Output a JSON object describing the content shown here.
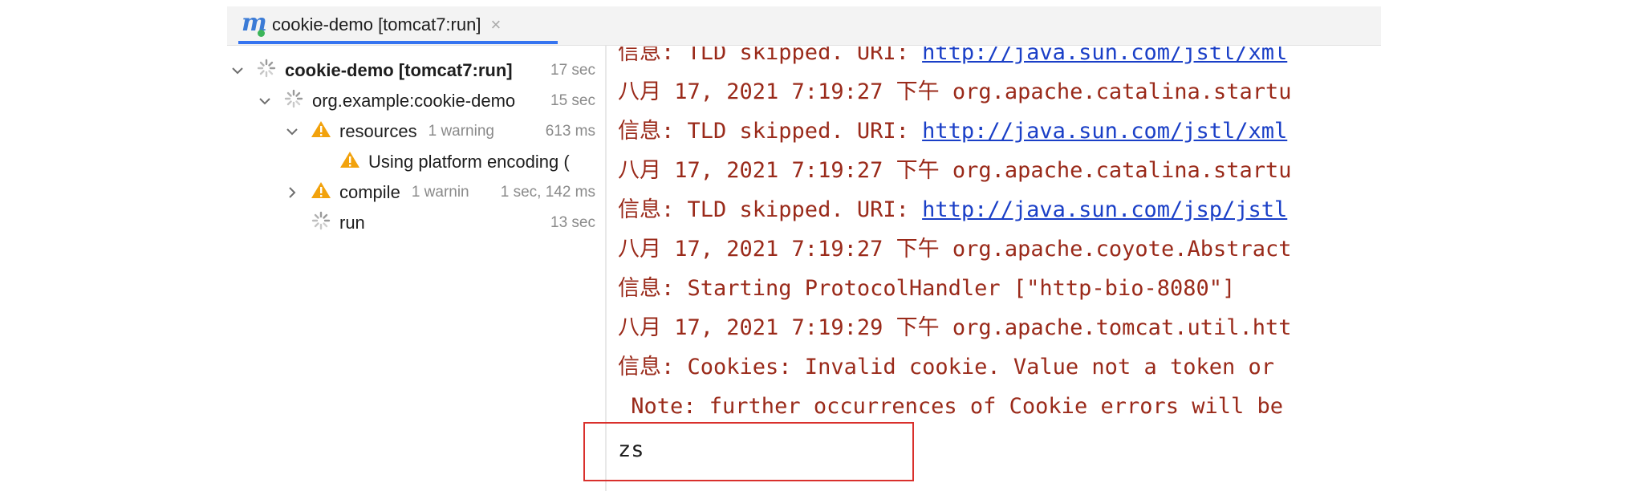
{
  "tab": {
    "title": "cookie-demo [tomcat7:run]",
    "close_glyph": "×"
  },
  "tree": {
    "root": {
      "label": "cookie-demo [tomcat7:run]",
      "time": "17 sec"
    },
    "module": {
      "label": "org.example:cookie-demo",
      "time": "15 sec"
    },
    "resources": {
      "label": "resources",
      "meta": "1 warning",
      "time": "613 ms"
    },
    "warning_msg": {
      "label": "Using platform encoding ("
    },
    "compile": {
      "label": "compile",
      "meta": "1 warnin",
      "time": "1 sec, 142 ms"
    },
    "run": {
      "label": "run",
      "time": "13 sec"
    }
  },
  "console": {
    "line0": {
      "text": "信息: TLD skipped. URI: ",
      "link": "http://java.sun.com/jstl/xml"
    },
    "line1": "八月 17, 2021 7:19:27 下午 org.apache.catalina.startu",
    "line2": {
      "text": "信息: TLD skipped. URI: ",
      "link": "http://java.sun.com/jstl/xml"
    },
    "line3": "八月 17, 2021 7:19:27 下午 org.apache.catalina.startu",
    "line4": {
      "text": "信息: TLD skipped. URI: ",
      "link": "http://java.sun.com/jsp/jstl"
    },
    "line5": "八月 17, 2021 7:19:27 下午 org.apache.coyote.Abstract",
    "line6": "信息: Starting ProtocolHandler [\"http-bio-8080\"]",
    "line7": "八月 17, 2021 7:19:29 下午 org.apache.tomcat.util.htt",
    "line8": "信息: Cookies: Invalid cookie. Value not a token or ",
    "line9": " Note: further occurrences of Cookie errors will be",
    "input": "zs"
  },
  "colors": {
    "accent": "#3574f0",
    "console_text": "#9a2a1a",
    "link": "#1a3fc7",
    "warning": "#f2a20c",
    "highlight": "#d9302c"
  },
  "icons": [
    "maven-icon",
    "spinner-icon",
    "warning-icon",
    "chevron-down-icon",
    "chevron-right-icon",
    "close-icon"
  ]
}
